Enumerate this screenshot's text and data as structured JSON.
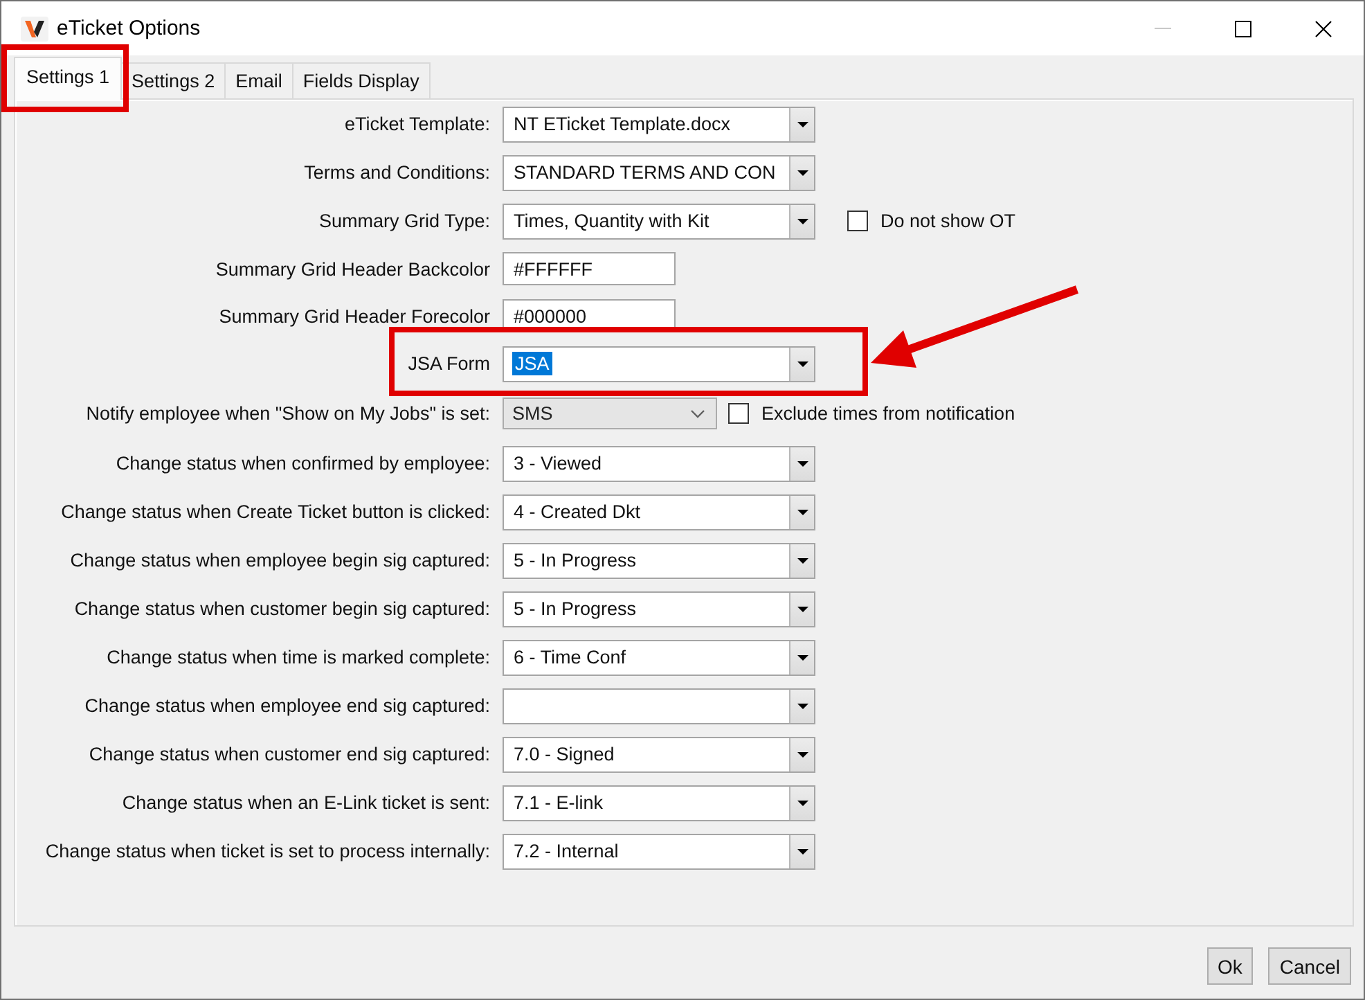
{
  "window": {
    "title": "eTicket Options",
    "buttons": [
      {
        "kind": "minimize",
        "disabled": true
      },
      {
        "kind": "maximize",
        "disabled": false
      },
      {
        "kind": "close",
        "disabled": false
      }
    ]
  },
  "tabs": [
    {
      "label": "Settings 1",
      "selected": true,
      "outlined": true
    },
    {
      "label": "Settings 2",
      "selected": false,
      "outlined": false
    },
    {
      "label": "Email",
      "selected": false,
      "outlined": false
    },
    {
      "label": "Fields Display",
      "selected": false,
      "outlined": false
    }
  ],
  "fields": [
    {
      "kind": "combo",
      "label": "eTicket Template:",
      "value": "NT ETicket Template.docx",
      "highlighted": false,
      "outlined": false
    },
    {
      "kind": "combo",
      "label": "Terms and Conditions:",
      "value": "STANDARD TERMS AND CON",
      "highlighted": false,
      "outlined": false
    },
    {
      "kind": "combo",
      "label": "Summary Grid Type:",
      "value": "Times, Quantity with Kit",
      "highlighted": false,
      "outlined": false,
      "checkbox": {
        "label": "Do not show OT",
        "checked": false
      }
    },
    {
      "kind": "text",
      "label": "Summary Grid Header Backcolor",
      "value": "#FFFFFF",
      "highlighted": false,
      "outlined": false
    },
    {
      "kind": "text",
      "label": "Summary Grid Header Forecolor",
      "value": "#000000",
      "highlighted": false,
      "outlined": false
    },
    {
      "kind": "combo",
      "label": "JSA Form",
      "value": "JSA",
      "highlighted": true,
      "outlined": true
    },
    {
      "kind": "dropdown",
      "label": "Notify employee when \"Show on My Jobs\" is set:",
      "value": "SMS",
      "highlighted": false,
      "outlined": false,
      "checkbox": {
        "label": "Exclude times from notification",
        "checked": false
      }
    },
    {
      "kind": "combo",
      "label": "Change status when confirmed by employee:",
      "value": "3 - Viewed",
      "highlighted": false,
      "outlined": false
    },
    {
      "kind": "combo",
      "label": "Change status when Create Ticket button is clicked:",
      "value": "4 - Created Dkt",
      "highlighted": false,
      "outlined": false
    },
    {
      "kind": "combo",
      "label": "Change status when employee begin sig captured:",
      "value": "5 - In Progress",
      "highlighted": false,
      "outlined": false
    },
    {
      "kind": "combo",
      "label": "Change status when customer begin sig captured:",
      "value": "5 - In Progress",
      "highlighted": false,
      "outlined": false
    },
    {
      "kind": "combo",
      "label": "Change status when time is marked complete:",
      "value": "6 - Time Conf",
      "highlighted": false,
      "outlined": false
    },
    {
      "kind": "combo",
      "label": "Change status when employee end sig captured:",
      "highlighted": false,
      "outlined": false
    },
    {
      "kind": "combo",
      "label": "Change status when customer end sig captured:",
      "value": "7.0 - Signed",
      "highlighted": false,
      "outlined": false
    },
    {
      "kind": "combo",
      "label": "Change status when an E-Link ticket is sent:",
      "value": "7.1 - E-link",
      "highlighted": false,
      "outlined": false
    },
    {
      "kind": "combo",
      "label": "Change status when ticket is set to process internally:",
      "value": "7.2 - Internal",
      "highlighted": false,
      "outlined": false
    }
  ],
  "arrow": true,
  "buttons": [
    {
      "label": "Ok"
    },
    {
      "label": "Cancel"
    }
  ]
}
